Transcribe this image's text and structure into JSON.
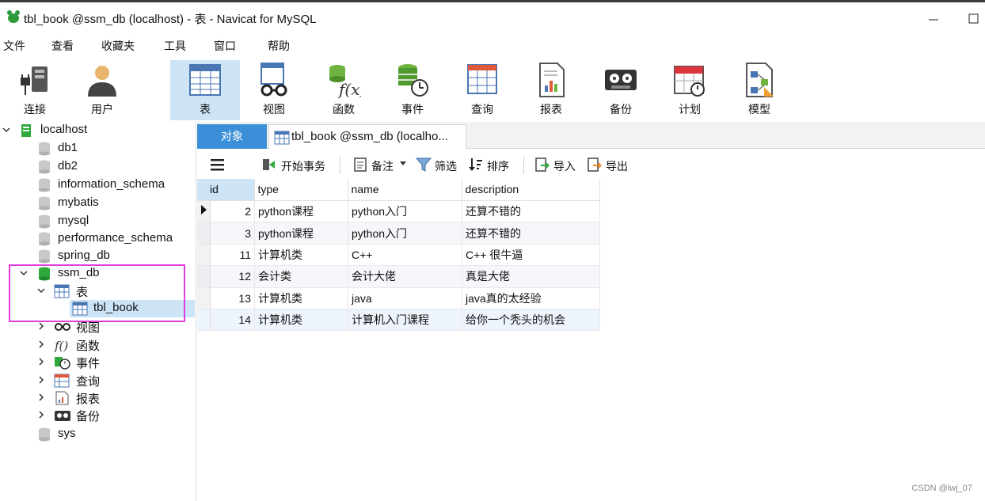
{
  "window": {
    "title": "tbl_book @ssm_db (localhost) - 表 - Navicat for MySQL",
    "minimize": "—",
    "maximize": "☐"
  },
  "menu": [
    "文件",
    "查看",
    "收藏夹",
    "工具",
    "窗口",
    "帮助"
  ],
  "toolbar": [
    {
      "label": "连接",
      "icon": "connection-icon"
    },
    {
      "label": "用户",
      "icon": "user-icon"
    },
    {
      "label": "表",
      "icon": "table-icon",
      "active": true
    },
    {
      "label": "视图",
      "icon": "view-icon"
    },
    {
      "label": "函数",
      "icon": "function-icon"
    },
    {
      "label": "事件",
      "icon": "event-icon"
    },
    {
      "label": "查询",
      "icon": "query-icon"
    },
    {
      "label": "报表",
      "icon": "report-icon"
    },
    {
      "label": "备份",
      "icon": "backup-icon"
    },
    {
      "label": "计划",
      "icon": "schedule-icon"
    },
    {
      "label": "模型",
      "icon": "model-icon"
    }
  ],
  "sidebar": {
    "connection": "localhost",
    "databases": [
      "db1",
      "db2",
      "information_schema",
      "mybatis",
      "mysql",
      "performance_schema",
      "spring_db"
    ],
    "open_db": "ssm_db",
    "tables_group": "表",
    "selected_table": "tbl_book",
    "groups": [
      "视图",
      "函数",
      "事件",
      "查询",
      "报表",
      "备份"
    ],
    "after_db": "sys"
  },
  "tabs": {
    "objects": "对象",
    "table_tab": "tbl_book @ssm_db (localho..."
  },
  "subtoolbar": {
    "begin_transaction": "开始事务",
    "comment": "备注",
    "filter": "筛选",
    "sort": "排序",
    "import": "导入",
    "export": "导出"
  },
  "grid": {
    "columns": [
      "id",
      "type",
      "name",
      "description"
    ],
    "rows": [
      [
        "2",
        "python课程",
        "python入门",
        "还算不错的"
      ],
      [
        "3",
        "python课程",
        "python入门",
        "还算不错的"
      ],
      [
        "11",
        "计算机类",
        "C++",
        "C++ 很牛逼"
      ],
      [
        "12",
        "会计类",
        "会计大佬",
        "真是大佬"
      ],
      [
        "13",
        "计算机类",
        "java",
        "java真的太经验"
      ],
      [
        "14",
        "计算机类",
        "计算机入门课程",
        "给你一个秃头的机会"
      ]
    ]
  },
  "watermark": "CSDN @lwj_07",
  "colors": {
    "accent": "#3b8fd9",
    "selection": "#cde4f7",
    "highlight_box": "#e03ce0",
    "db_green": "#2eaa3c"
  }
}
